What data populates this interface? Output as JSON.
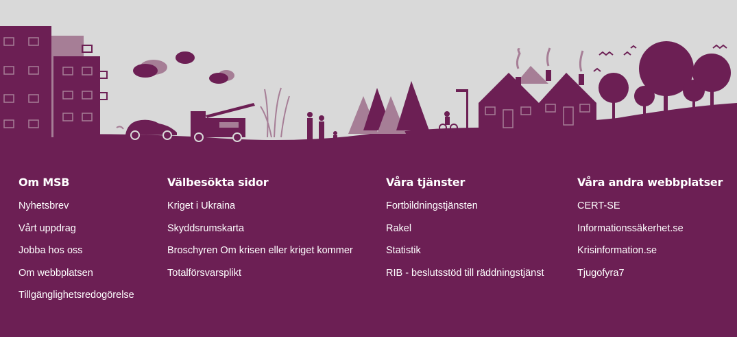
{
  "colors": {
    "primary": "#6c1f54",
    "secondary": "#a67e96",
    "sky": "#d9d9d9",
    "text": "#ffffff"
  },
  "illustration": {
    "description_icon": "city-to-countryside-silhouette"
  },
  "columns": [
    {
      "heading": "Om MSB",
      "links": [
        "Nyhetsbrev",
        "Vårt uppdrag",
        "Jobba hos oss",
        "Om webbplatsen",
        "Tillgänglighetsredogörelse"
      ]
    },
    {
      "heading": "Välbesökta sidor",
      "links": [
        "Kriget i Ukraina",
        "Skyddsrumskarta",
        "Broschyren Om krisen eller kriget kommer",
        "Totalförsvarsplikt"
      ]
    },
    {
      "heading": "Våra tjänster",
      "links": [
        "Fortbildningstjänsten",
        "Rakel",
        "Statistik",
        "RIB - beslutsstöd till räddningstjänst"
      ]
    },
    {
      "heading": "Våra andra webbplatser",
      "links": [
        "CERT-SE",
        "Informationssäkerhet.se",
        "Krisinformation.se",
        "Tjugofyra7"
      ]
    }
  ]
}
